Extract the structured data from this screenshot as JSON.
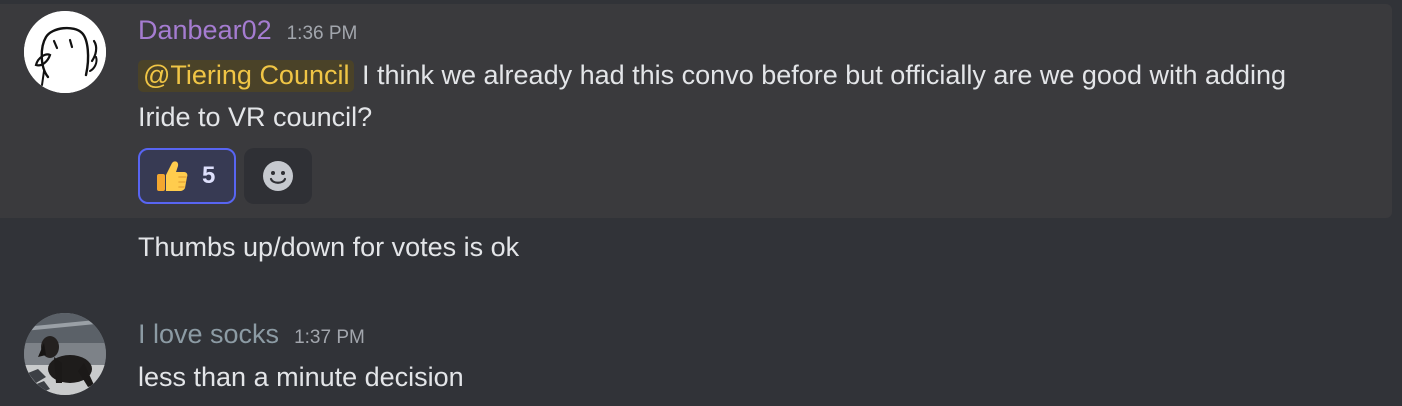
{
  "messages": [
    {
      "username": "Danbear02",
      "timestamp": "1:36 PM",
      "mention": "@Tiering Council",
      "text": " I think we already had this convo before but officially are we good with adding Iride to VR council?",
      "reactions": [
        {
          "emoji": "thumbs-up",
          "count": "5"
        }
      ],
      "followup": "Thumbs up/down for votes is ok"
    },
    {
      "username": "I love socks",
      "timestamp": "1:37 PM",
      "text": "less than a minute decision"
    }
  ],
  "colors": {
    "background": "#313338",
    "username_1": "#a57cd1",
    "username_2": "#8c9ba4",
    "mention_text": "#f0c545",
    "reaction_border": "#5865f2"
  },
  "icons": {
    "reaction": "thumbs-up-icon",
    "add_reaction": "add-reaction-smiley-icon"
  }
}
